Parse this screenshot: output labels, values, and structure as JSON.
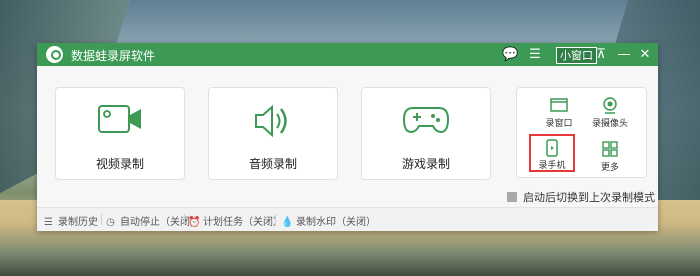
{
  "titlebar": {
    "app_title": "数据蛙录屏软件",
    "mini_window_label": "小窗口",
    "icons": [
      "chat-icon",
      "menu-icon",
      "pin-icon",
      "minimize-icon",
      "close-icon"
    ],
    "glyphs": {
      "chat": "💬",
      "menu": "☰",
      "pin": "⊼",
      "minimize": "—",
      "close": "✕"
    }
  },
  "cards": [
    {
      "label": "视频录制",
      "icon": "video-camera-icon"
    },
    {
      "label": "音频录制",
      "icon": "speaker-icon"
    },
    {
      "label": "游戏录制",
      "icon": "gamepad-icon"
    }
  ],
  "panel": {
    "items": [
      {
        "label": "录窗口",
        "icon": "window-icon"
      },
      {
        "label": "录摄像头",
        "icon": "webcam-icon"
      },
      {
        "label": "录手机",
        "icon": "phone-icon",
        "highlighted": true
      },
      {
        "label": "更多",
        "icon": "grid-icon"
      }
    ]
  },
  "checkbox": {
    "label": "启动后切换到上次录制模式",
    "checked": false
  },
  "footer": {
    "items": [
      {
        "label": "录制历史",
        "icon": "list-icon",
        "glyph": "☰"
      },
      {
        "label": "自动停止（关闭）",
        "icon": "clock-icon",
        "glyph": "◷"
      },
      {
        "label": "计划任务（关闭）",
        "icon": "alarm-icon",
        "glyph": "⏰"
      },
      {
        "label": "录制水印（关闭）",
        "icon": "drop-icon",
        "glyph": "💧"
      }
    ]
  },
  "colors": {
    "accent": "#3c9a55",
    "highlight": "#e53935"
  }
}
